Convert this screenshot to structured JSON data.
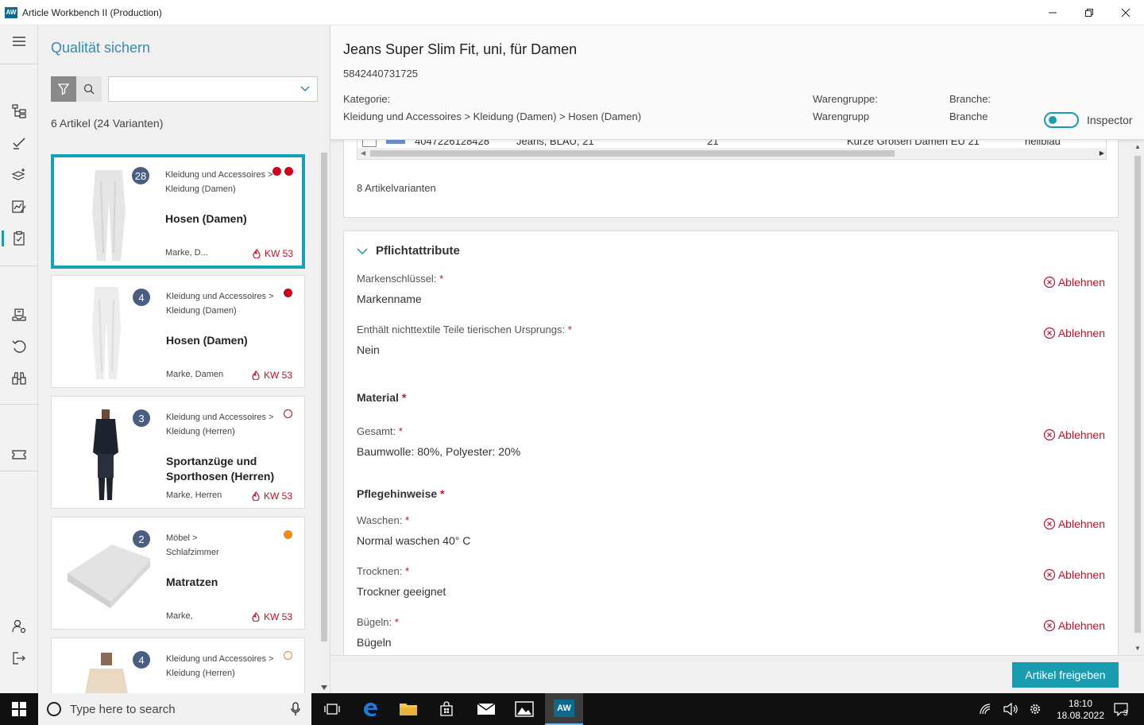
{
  "window": {
    "logo": "AW",
    "title": "Article Workbench II (Production)",
    "controls": [
      "minimize",
      "maximize",
      "close"
    ]
  },
  "nav": {
    "items": [
      "menu-icon",
      "tree-icon",
      "checkmark-icon",
      "layers-icon",
      "chart-edit-icon",
      "clipboard-check-icon",
      "package-icon",
      "undo-icon",
      "binoculars-icon",
      "ticket-icon",
      "user-settings-icon",
      "logout-icon"
    ],
    "active": "clipboard-check-icon"
  },
  "list": {
    "title": "Qualität sichern",
    "filter_value": "",
    "count": "6 Artikel (24 Varianten)",
    "cards": [
      {
        "badge": "28",
        "cat1": "Kleidung und Accessoires >",
        "cat2": "Kleidung (Damen)",
        "name": "Hosen (Damen)",
        "brand": "Marke, D...",
        "week": "KW 53",
        "dots": [
          "red",
          "red"
        ],
        "selected": true
      },
      {
        "badge": "4",
        "cat1": "Kleidung und Accessoires >",
        "cat2": "Kleidung (Damen)",
        "name": "Hosen (Damen)",
        "brand": "Marke, Damen",
        "week": "KW 53",
        "dots": [
          "red"
        ]
      },
      {
        "badge": "3",
        "cat1": "Kleidung und Accessoires >",
        "cat2": "Kleidung (Herren)",
        "name": "Sportanzüge und Sporthosen (Herren)",
        "brand": "Marke, Herren",
        "week": "KW 53",
        "dots": [
          "red-outline"
        ]
      },
      {
        "badge": "2",
        "cat1": "Möbel >",
        "cat2": "Schlafzimmer",
        "name": "Matratzen",
        "brand": "Marke,",
        "week": "KW 53",
        "dots": [
          "orange"
        ]
      },
      {
        "badge": "4",
        "cat1": "Kleidung und Accessoires >",
        "cat2": "Kleidung (Herren)",
        "name": "",
        "brand": "",
        "week": "",
        "dots": [
          "orange-outline"
        ]
      }
    ]
  },
  "detail": {
    "title": "Jeans Super Slim Fit, uni, für Damen",
    "ean": "5842440731725",
    "category_label": "Kategorie:",
    "category_value": "Kleidung und Accessoires > Kleidung (Damen) > Hosen (Damen)",
    "warengruppe_label": "Warengruppe:",
    "warengruppe_value": "Warengrupp",
    "branche_label": "Branche:",
    "branche_value": "Branche",
    "inspector_label": "Inspector",
    "inspector_on": true,
    "variant_row": {
      "ean": "4047226128428",
      "desc": "Jeans, BLAU, 21",
      "size": "21",
      "size_group": "Kurze Größen Damen EU 21",
      "color": "hellblau"
    },
    "variants_count": "8 Artikelvarianten",
    "section_title": "Pflichtattribute",
    "reject_label": "Ablehnen",
    "attributes": {
      "markenschluessel_label": "Markenschlüssel:",
      "markenschluessel_value": "Markenname",
      "tierisch_label": "Enthält nichttextile Teile tierischen Ursprungs:",
      "tierisch_value": "Nein",
      "material_group": "Material",
      "gesamt_label": "Gesamt:",
      "gesamt_value": "Baumwolle: 80%, Polyester: 20%",
      "pflege_group": "Pflegehinweise",
      "waschen_label": "Waschen:",
      "waschen_value": "Normal waschen 40° C",
      "trocknen_label": "Trocknen:",
      "trocknen_value": "Trockner geeignet",
      "buegeln_label": "Bügeln:",
      "buegeln_value": "Bügeln"
    },
    "required_marker": "*",
    "release_button": "Artikel freigeben"
  },
  "taskbar": {
    "search_placeholder": "Type here to search",
    "app_label": "AW",
    "time": "18:10",
    "date": "18.08.2022",
    "notification_count": "3"
  }
}
